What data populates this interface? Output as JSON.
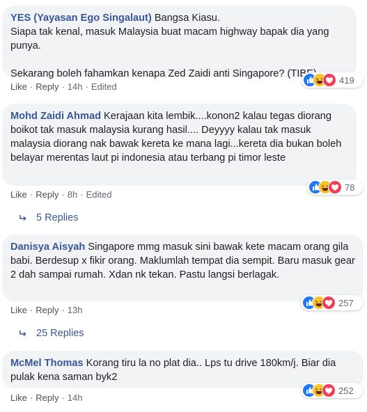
{
  "comments": [
    {
      "author": "YES (Yayasan Ego Singalaut)",
      "text": "Bangsa Kiasu.\nSiapa tak kenal, masuk Malaysia buat macam highway bapak dia yang punya.\n\nSekarang boleh fahamkan kenapa Zed Zaidi anti Singapore? (TIBE)",
      "like_label": "Like",
      "reply_label": "Reply",
      "time": "14h",
      "edited": "Edited",
      "reaction_count": "419",
      "reactions": [
        "like-icon",
        "haha-icon",
        "love-icon"
      ]
    },
    {
      "author": "Mohd Zaidi Ahmad",
      "text": "Kerajaan kita lembik....konon2 kalau tegas diorang boikot tak masuk malaysia kurang hasil.... Deyyyy kalau tak masuk malaysia diorang nak bawak kereta ke mana lagi...kereta dia bukan boleh belayar merentas laut pi indonesia atau terbang pi timor leste",
      "like_label": "Like",
      "reply_label": "Reply",
      "time": "8h",
      "edited": "Edited",
      "reaction_count": "78",
      "reactions": [
        "like-icon",
        "haha-icon",
        "love-icon"
      ],
      "replies_label": "5 Replies"
    },
    {
      "author": "Danisya Aisyah",
      "text": "Singapore mmg masuk sini bawak kete macam orang gila babi. Berdesup x fikir orang. Maklumlah tempat dia sempit. Baru masuk gear 2 dah sampai rumah. Xdan nk tekan. Pastu langsi berlagak.",
      "like_label": "Like",
      "reply_label": "Reply",
      "time": "13h",
      "reaction_count": "257",
      "reactions": [
        "like-icon",
        "haha-icon",
        "love-icon"
      ],
      "replies_label": "25 Replies"
    },
    {
      "author": "McMel Thomas",
      "text": "Korang tiru la no plat dia.. Lps tu drive 180km/j. Biar dia pulak kena saman byk2",
      "like_label": "Like",
      "reply_label": "Reply",
      "time": "14h",
      "reaction_count": "252",
      "reactions": [
        "like-icon",
        "haha-icon",
        "love-icon"
      ]
    }
  ],
  "colors": {
    "author": "#385898",
    "bubble": "#f2f3f5",
    "meta": "#606770",
    "like": "#2078f4",
    "haha": "#f7c42e",
    "love": "#f33e58"
  }
}
